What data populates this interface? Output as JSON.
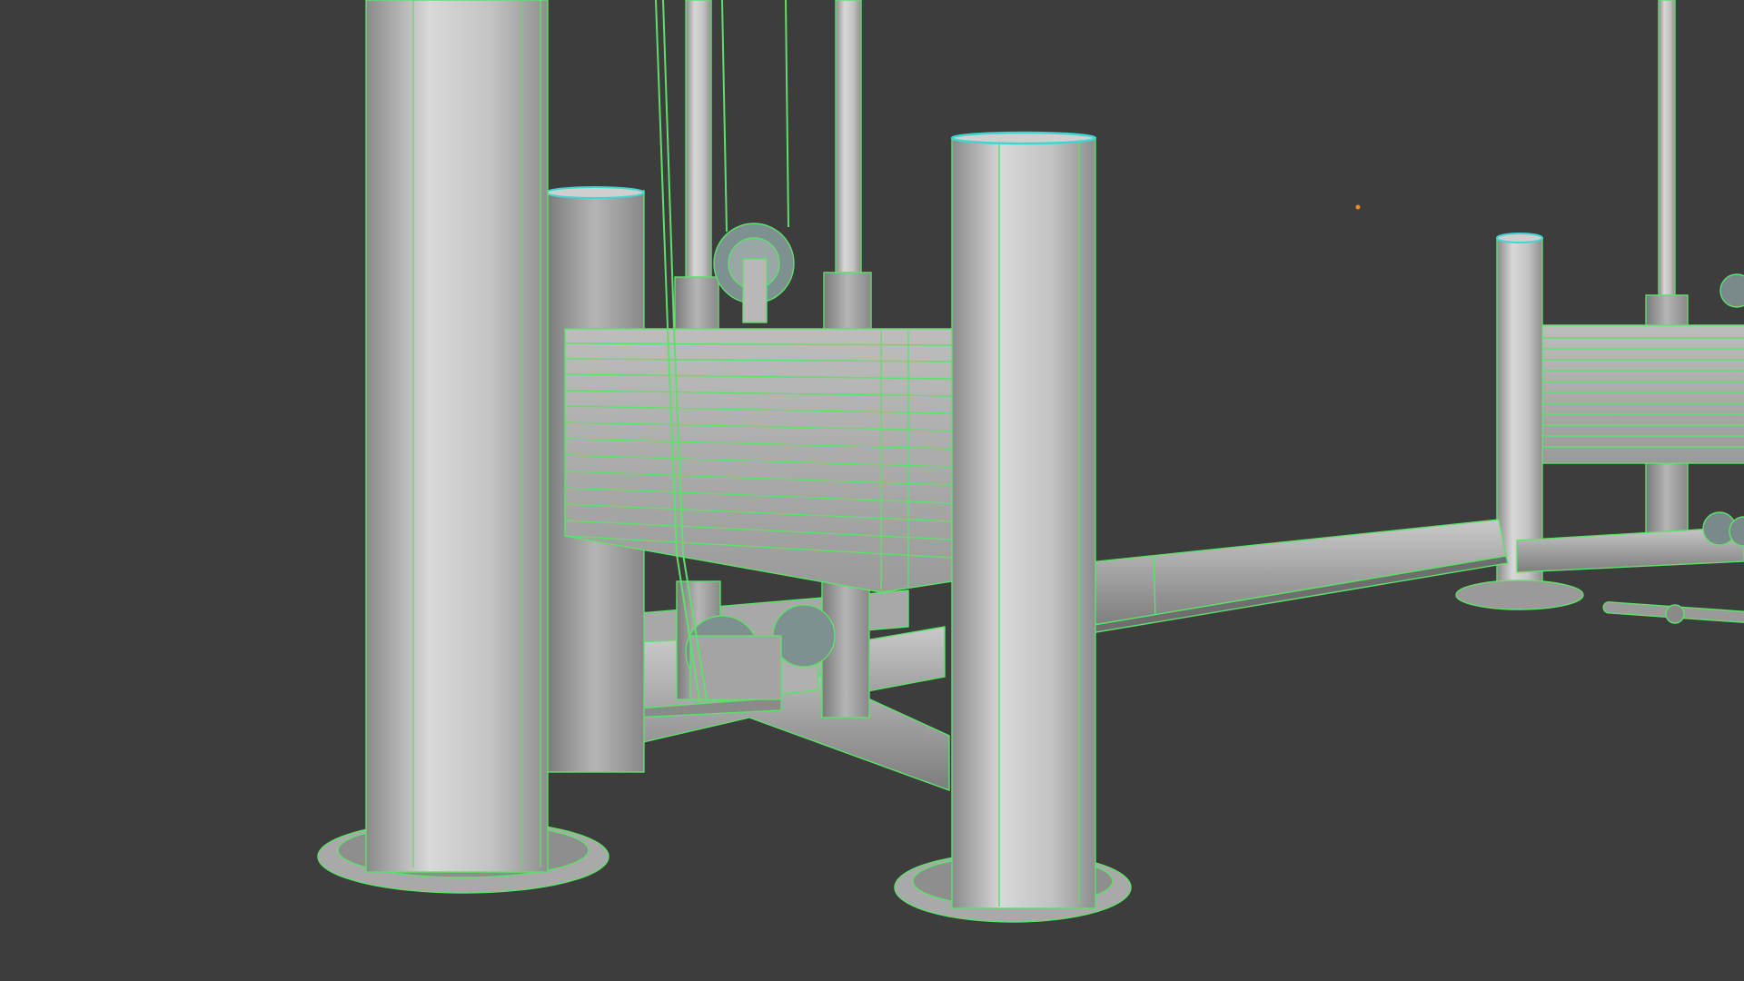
{
  "viewport": {
    "background": "#3d3d3d",
    "wire_color": "#5ee06a",
    "selected_edge_color": "#3fd6d0",
    "marker_color": "#f08a24",
    "shading": "wireframe-on-shaded"
  },
  "scene": {
    "object": "cable-crossover-machine",
    "parts": [
      "upright-posts",
      "weight-stacks",
      "pulleys",
      "guide-rods",
      "base-frame",
      "crossbar",
      "cable-handle"
    ]
  }
}
